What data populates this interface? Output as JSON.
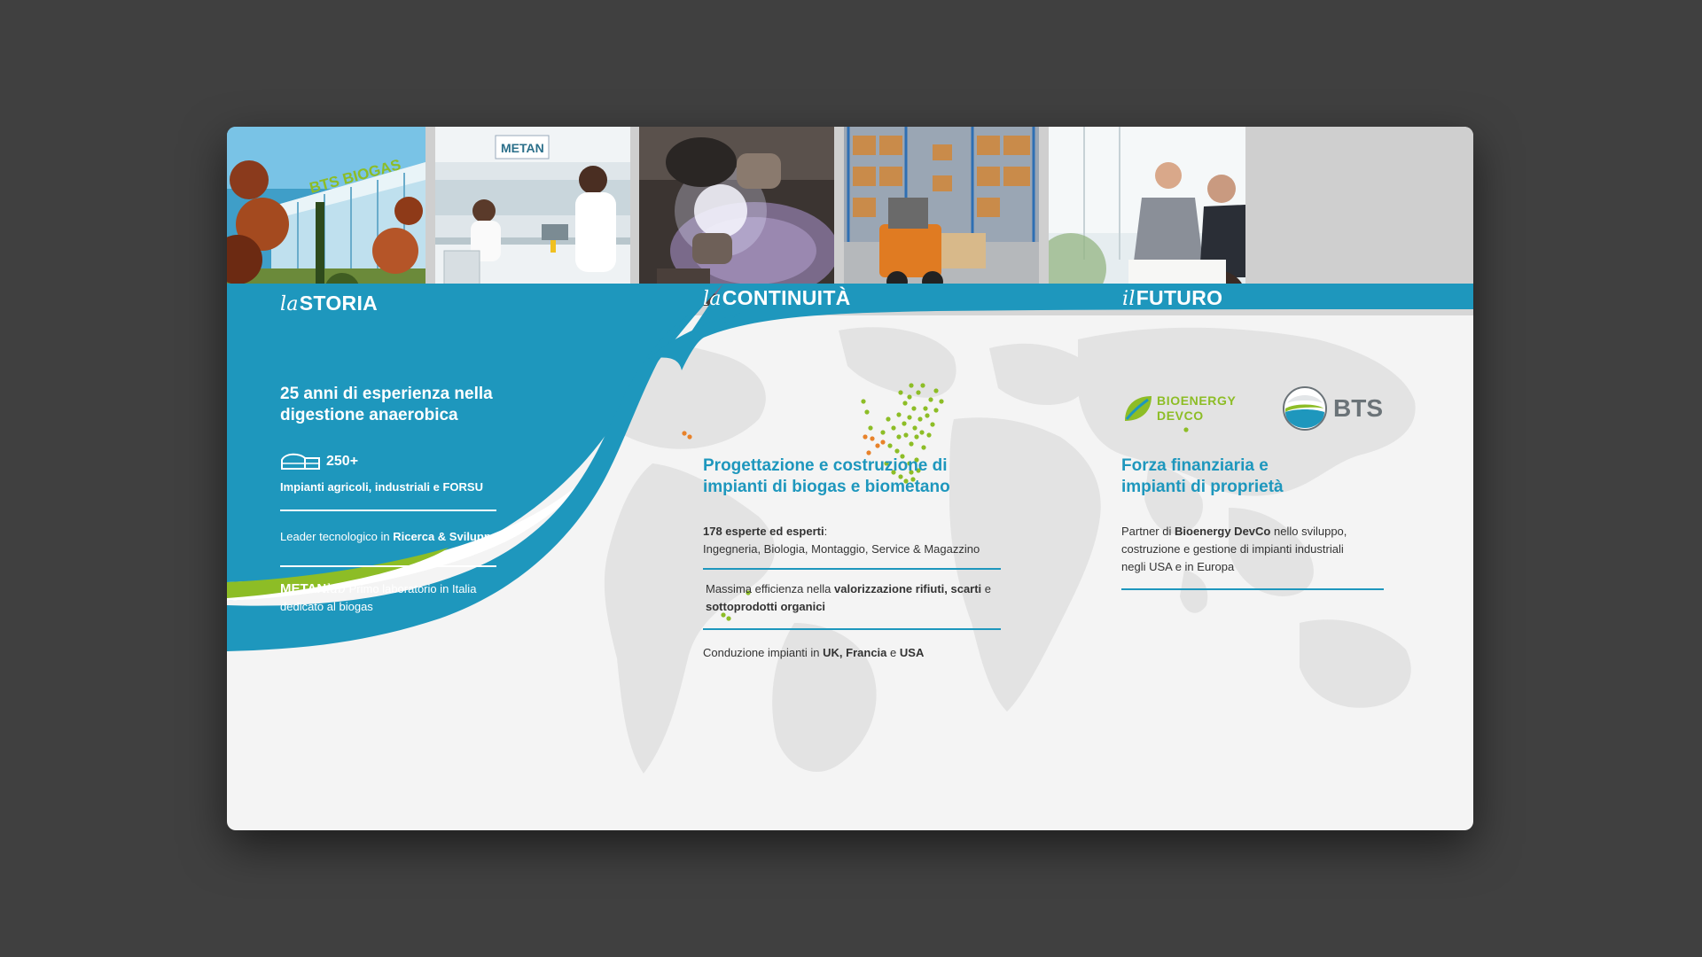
{
  "columns": {
    "storia": {
      "heading_prefix": "la",
      "heading": "STORIA",
      "subtitle_line1": "25 anni di esperienza nella",
      "subtitle_line2": "digestione anaerobica",
      "stat_value": "250+",
      "stat_label": "Impianti agricoli, industriali e FORSU",
      "leader_text": "Leader tecnologico in",
      "leader_bold": "Ricerca & Sviluppo",
      "metan_brand": "METAN",
      "metan_brand_suffix": "lab",
      "metan_text_line1": "Primo laboratorio in Italia",
      "metan_text_line2": "dedicato al biogas"
    },
    "continuita": {
      "heading_prefix": "la",
      "heading": "CONTINUITÀ",
      "title_line1": "Progettazione e costruzione di",
      "title_line2": "impianti di biogas e biometano",
      "experts_bold": "178 esperte ed esperti",
      "experts_colon": ":",
      "experts_list": "Ingegneria, Biologia, Montaggio, Service & Magazzino",
      "eff_text": "Massima efficienza nella",
      "eff_bold": "valorizzazione rifiuti, scarti",
      "eff_and": "e",
      "eff_bold2": "sottoprodotti organici",
      "cond_text": "Conduzione impianti in",
      "cond_uk": "UK, Francia",
      "cond_e": "e",
      "cond_usa": "USA"
    },
    "futuro": {
      "heading_prefix": "il",
      "heading": "FUTURO",
      "logo1_line1": "BIOENERGY",
      "logo1_line2": "DEVCO",
      "logo2": "BTS",
      "title_line1": "Forza finanziaria e",
      "title_line2": "impianti di proprietà",
      "partner_text": "Partner di",
      "partner_bold": "Bioenergy DevCo",
      "partner_rest": "nello sviluppo,",
      "partner_line2": "costruzione e gestione di impianti industriali",
      "partner_line3": "negli USA e in Europa"
    }
  },
  "photos": {
    "building_sign": "BTS BIOGAS",
    "lab_sign": "METAN"
  },
  "colors": {
    "brand_blue": "#1e97bd",
    "brand_green": "#8dbd26",
    "map_orange": "#e8822a"
  }
}
